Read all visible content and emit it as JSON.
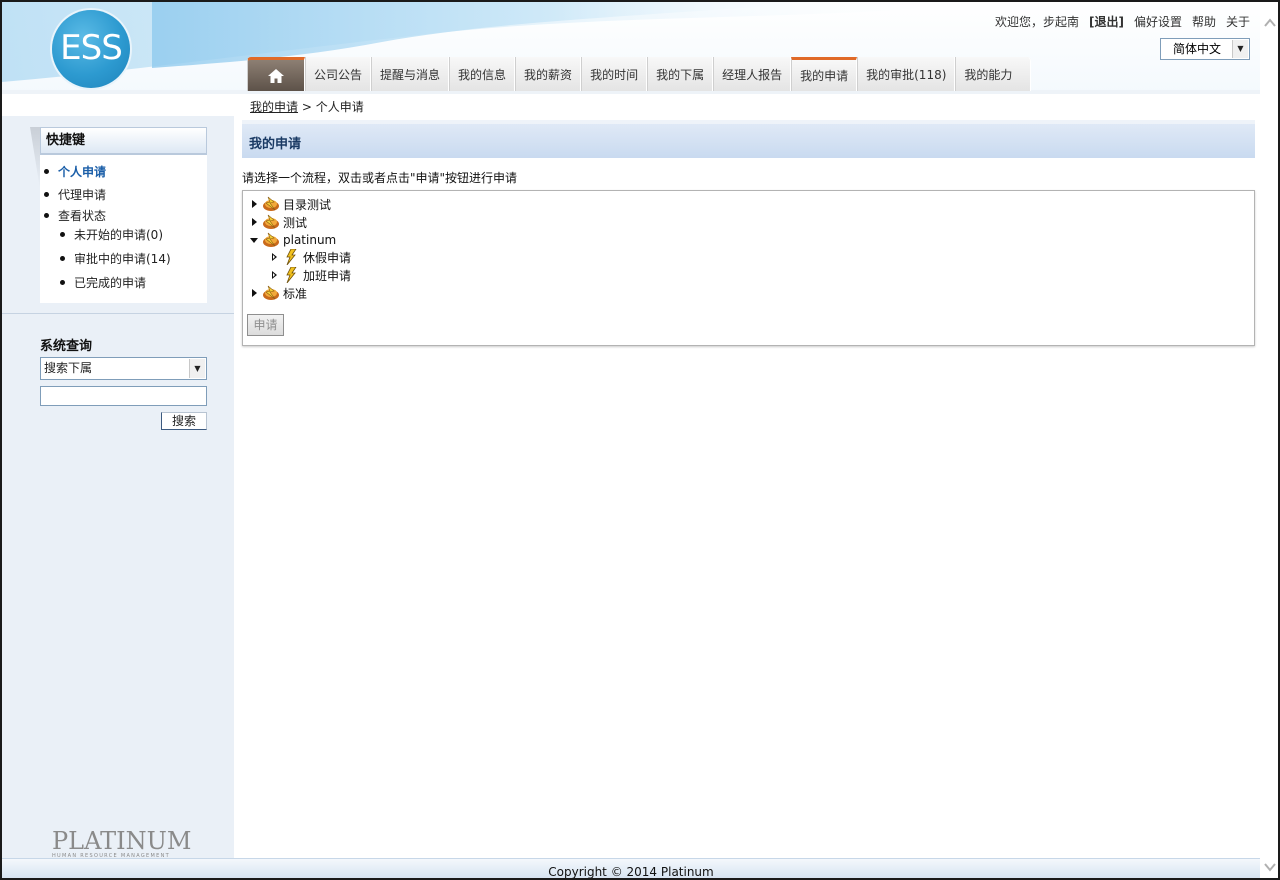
{
  "header": {
    "logo_text": "ESS",
    "welcome": "欢迎您，步起南",
    "logout": "[退出]",
    "preferences": "偏好设置",
    "help": "帮助",
    "about": "关于",
    "language": "简体中文"
  },
  "nav": {
    "tabs": [
      "公司公告",
      "提醒与消息",
      "我的信息",
      "我的薪资",
      "我的时间",
      "我的下属",
      "经理人报告",
      "我的申请",
      "我的审批(118)",
      "我的能力"
    ],
    "active": "我的申请"
  },
  "breadcrumb": {
    "parent": "我的申请",
    "separator": " > ",
    "current": "个人申请"
  },
  "sidebar": {
    "quick_title": "快捷键",
    "items": [
      {
        "label": "个人申请"
      },
      {
        "label": "代理申请"
      },
      {
        "label": "查看状态"
      },
      {
        "label": "未开始的申请(0)"
      },
      {
        "label": "审批中的申请(14)"
      },
      {
        "label": "已完成的申请"
      }
    ],
    "search_title": "系统查询",
    "search_select": "搜索下属",
    "search_input": "",
    "search_button": "搜索",
    "brand_big": "PLATINUM",
    "brand_small": "HUMAN RESOURCE MANAGEMENT"
  },
  "main": {
    "title": "我的申请",
    "instruction": "请选择一个流程，双击或者点击\"申请\"按钮进行申请",
    "tree": [
      {
        "label": "目录测试",
        "state": "collapsed"
      },
      {
        "label": "测试",
        "state": "collapsed"
      },
      {
        "label": "platinum",
        "state": "expanded"
      },
      {
        "label": "休假申请",
        "state": "leaf"
      },
      {
        "label": "加班申请",
        "state": "leaf"
      },
      {
        "label": "标准",
        "state": "collapsed"
      }
    ],
    "apply_button": "申请"
  },
  "footer": {
    "copyright": "Copyright © 2014 Platinum"
  },
  "colors": {
    "accent_orange": "#e06a28",
    "link_blue": "#1a5ea8",
    "panel_blue": "#c9daf0",
    "sidebar_bg": "#eaf0f7"
  }
}
